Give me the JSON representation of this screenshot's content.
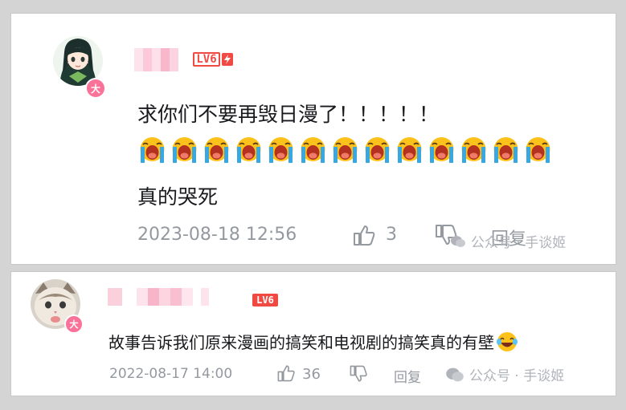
{
  "comments": [
    {
      "level": "LV6",
      "badge": "大",
      "lines": [
        "求你们不要再毁日漫了！！！！！"
      ],
      "emoji_count": 13,
      "emoji_name": "loudly-crying-emoji",
      "after_line": "真的哭死",
      "date": "2023-08-18 12:56",
      "likes": "3",
      "reply_label": "回复",
      "watermark": "公众号 · 手谈姬"
    },
    {
      "level": "LV6",
      "badge": "大",
      "lines": [
        "故事告诉我们原来漫画的搞笑和电视剧的搞笑真的有壁"
      ],
      "inline_emoji": "laughing-crying-emoji",
      "date": "2022-08-17 14:00",
      "likes": "36",
      "reply_label": "回复",
      "watermark": "公众号 · 手谈姬"
    }
  ],
  "colors": {
    "level_red": "#f04a43",
    "badge_pink": "#fb7299",
    "text": "#18191c",
    "meta": "#9499a0"
  }
}
